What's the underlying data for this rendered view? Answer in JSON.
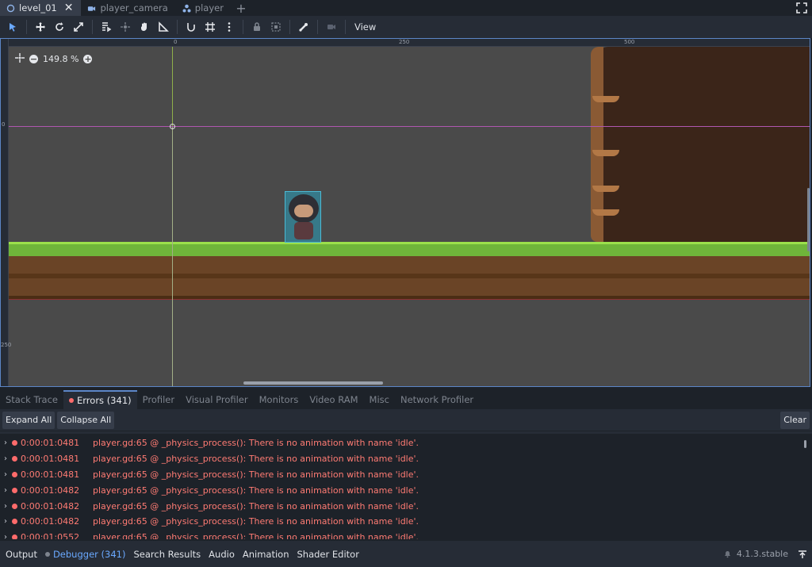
{
  "scene_tabs": [
    {
      "label": "level_01",
      "icon": "circle-node-icon",
      "active": true
    },
    {
      "label": "player_camera",
      "icon": "camera-icon",
      "active": false
    },
    {
      "label": "player",
      "icon": "node-tree-icon",
      "active": false
    }
  ],
  "toolbar": {
    "view_label": "View"
  },
  "viewport": {
    "zoom_label": "149.8 %",
    "ruler_top_labels": [
      "0",
      "250",
      "500"
    ],
    "ruler_left_labels": [
      "0",
      "250"
    ]
  },
  "debugger": {
    "tabs": [
      "Stack Trace",
      "Errors (341)",
      "Profiler",
      "Visual Profiler",
      "Monitors",
      "Video RAM",
      "Misc",
      "Network Profiler"
    ],
    "expand_all": "Expand All",
    "collapse_all": "Collapse All",
    "clear": "Clear",
    "errors": [
      {
        "time": "0:00:01:0481",
        "message": "player.gd:65 @ _physics_process(): There is no animation with name 'idle'."
      },
      {
        "time": "0:00:01:0481",
        "message": "player.gd:65 @ _physics_process(): There is no animation with name 'idle'."
      },
      {
        "time": "0:00:01:0481",
        "message": "player.gd:65 @ _physics_process(): There is no animation with name 'idle'."
      },
      {
        "time": "0:00:01:0482",
        "message": "player.gd:65 @ _physics_process(): There is no animation with name 'idle'."
      },
      {
        "time": "0:00:01:0482",
        "message": "player.gd:65 @ _physics_process(): There is no animation with name 'idle'."
      },
      {
        "time": "0:00:01:0482",
        "message": "player.gd:65 @ _physics_process(): There is no animation with name 'idle'."
      },
      {
        "time": "0:00:01:0552",
        "message": "player.gd:65 @ _physics_process(): There is no animation with name 'idle'."
      }
    ]
  },
  "statusbar": {
    "items": [
      "Output",
      "Debugger (341)",
      "Search Results",
      "Audio",
      "Animation",
      "Shader Editor"
    ],
    "version": "4.1.3.stable"
  },
  "colors": {
    "accent": "#5c86c7",
    "error": "#ff7b73",
    "debugger_active": "#6aa9ff"
  }
}
